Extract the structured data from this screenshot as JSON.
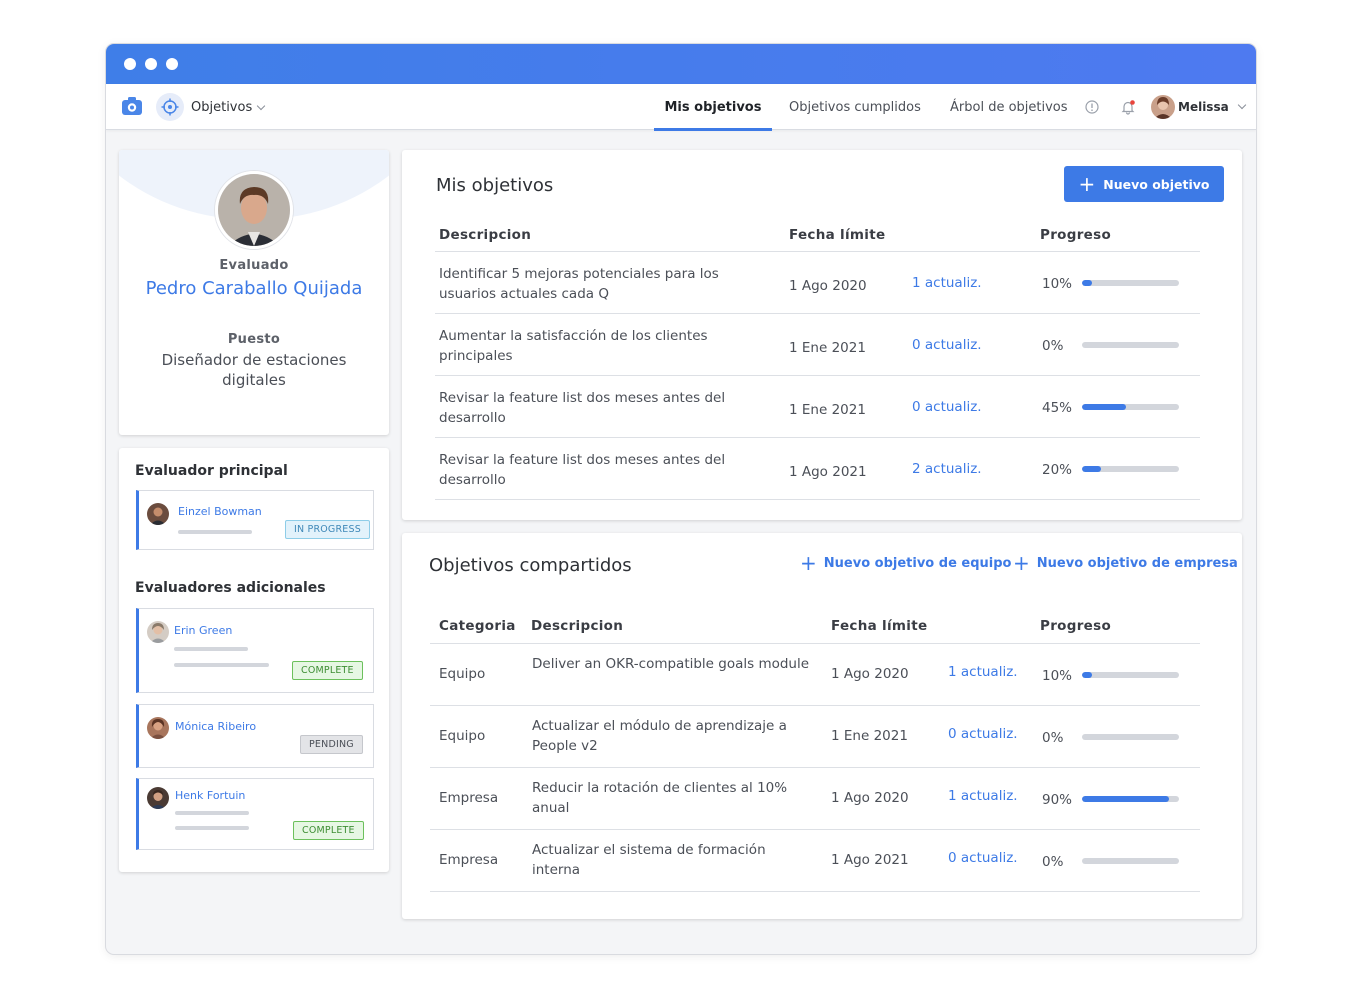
{
  "nav": {
    "module": "Objetivos",
    "tabs": [
      "Mis objetivos",
      "Objetivos cumplidos",
      "Árbol de objetivos"
    ],
    "user": "Melissa"
  },
  "profile": {
    "evaluated_label": "Evaluado",
    "name": "Pedro Caraballo Quijada",
    "position_label": "Puesto",
    "position": "Diseñador de estaciones digitales"
  },
  "evaluators": {
    "main_title": "Evaluador principal",
    "main": {
      "name": "Einzel Bowman",
      "status": "IN PROGRESS"
    },
    "additional_title": "Evaluadores adicionales",
    "additional": [
      {
        "name": "Erin Green",
        "status": "COMPLETE"
      },
      {
        "name": "Mónica Ribeiro",
        "status": "PENDING"
      },
      {
        "name": "Henk Fortuin",
        "status": "COMPLETE"
      }
    ]
  },
  "my_goals": {
    "title": "Mis objetivos",
    "new_button": "Nuevo objetivo",
    "headers": {
      "description": "Descripcion",
      "deadline": "Fecha límite",
      "progress": "Progreso"
    },
    "rows": [
      {
        "description": "Identificar 5 mejoras potenciales para los usuarios actuales cada Q",
        "deadline": "1 Ago 2020",
        "updates": "1 actualiz.",
        "progress_label": "10%",
        "progress": 0.1
      },
      {
        "description": "Aumentar la satisfacción de los clientes principales",
        "deadline": "1 Ene 2021",
        "updates": "0 actualiz.",
        "progress_label": "0%",
        "progress": 0.0
      },
      {
        "description": "Revisar la feature list dos meses antes del desarrollo",
        "deadline": "1 Ene 2021",
        "updates": "0 actualiz.",
        "progress_label": "45%",
        "progress": 0.45
      },
      {
        "description": "Revisar la feature list dos meses antes del desarrollo",
        "deadline": "1 Ago 2021",
        "updates": "2 actualiz.",
        "progress_label": "20%",
        "progress": 0.2
      }
    ]
  },
  "shared_goals": {
    "title": "Objetivos compartidos",
    "team_button": "Nuevo objetivo de equipo",
    "company_button": "Nuevo objetivo de empresa",
    "headers": {
      "category": "Categoria",
      "description": "Descripcion",
      "deadline": "Fecha límite",
      "progress": "Progreso"
    },
    "rows": [
      {
        "category": "Equipo",
        "description": "Deliver an OKR-compatible goals module",
        "deadline": "1 Ago 2020",
        "updates": "1 actualiz.",
        "progress_label": "10%",
        "progress": 0.1
      },
      {
        "category": "Equipo",
        "description": "Actualizar el módulo de aprendizaje a People v2",
        "deadline": "1 Ene 2021",
        "updates": "0 actualiz.",
        "progress_label": "0%",
        "progress": 0.0
      },
      {
        "category": "Empresa",
        "description": "Reducir la rotación de clientes al 10% anual",
        "deadline": "1 Ago 2020",
        "updates": "1 actualiz.",
        "progress_label": "90%",
        "progress": 0.9
      },
      {
        "category": "Empresa",
        "description": "Actualizar el sistema de formación interna",
        "deadline": "1 Ago 2021",
        "updates": "0 actualiz.",
        "progress_label": "0%",
        "progress": 0.0
      }
    ]
  },
  "colors": {
    "accent": "#3d7ae6",
    "titlebar": "#4a7cec",
    "background": "#f4f5f7"
  },
  "icons": [
    "gear-icon",
    "target-icon",
    "info-icon",
    "bell-icon",
    "chevron-down-icon",
    "plus-icon"
  ]
}
